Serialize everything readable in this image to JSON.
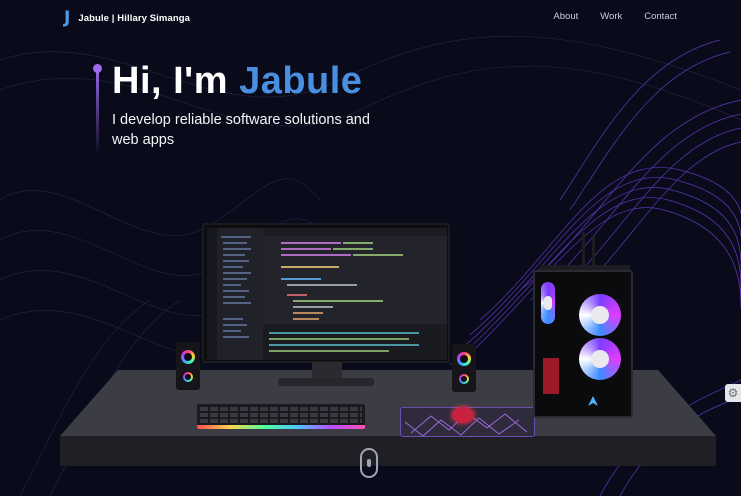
{
  "brand": {
    "mark": "J",
    "text": "Jabule | Hillary Simanga"
  },
  "nav": {
    "links": [
      "About",
      "Work",
      "Contact"
    ]
  },
  "hero": {
    "greeting": "Hi, I'm ",
    "name": "Jabule",
    "subtitle": "I develop reliable software solutions and web apps"
  },
  "colors": {
    "background": "#0a0b1a",
    "accent_blue": "#4a8ee0",
    "accent_purple": "#9b6cf1"
  },
  "icons": {
    "scroll": "mouse-scroll-icon",
    "settings": "gear-icon"
  }
}
